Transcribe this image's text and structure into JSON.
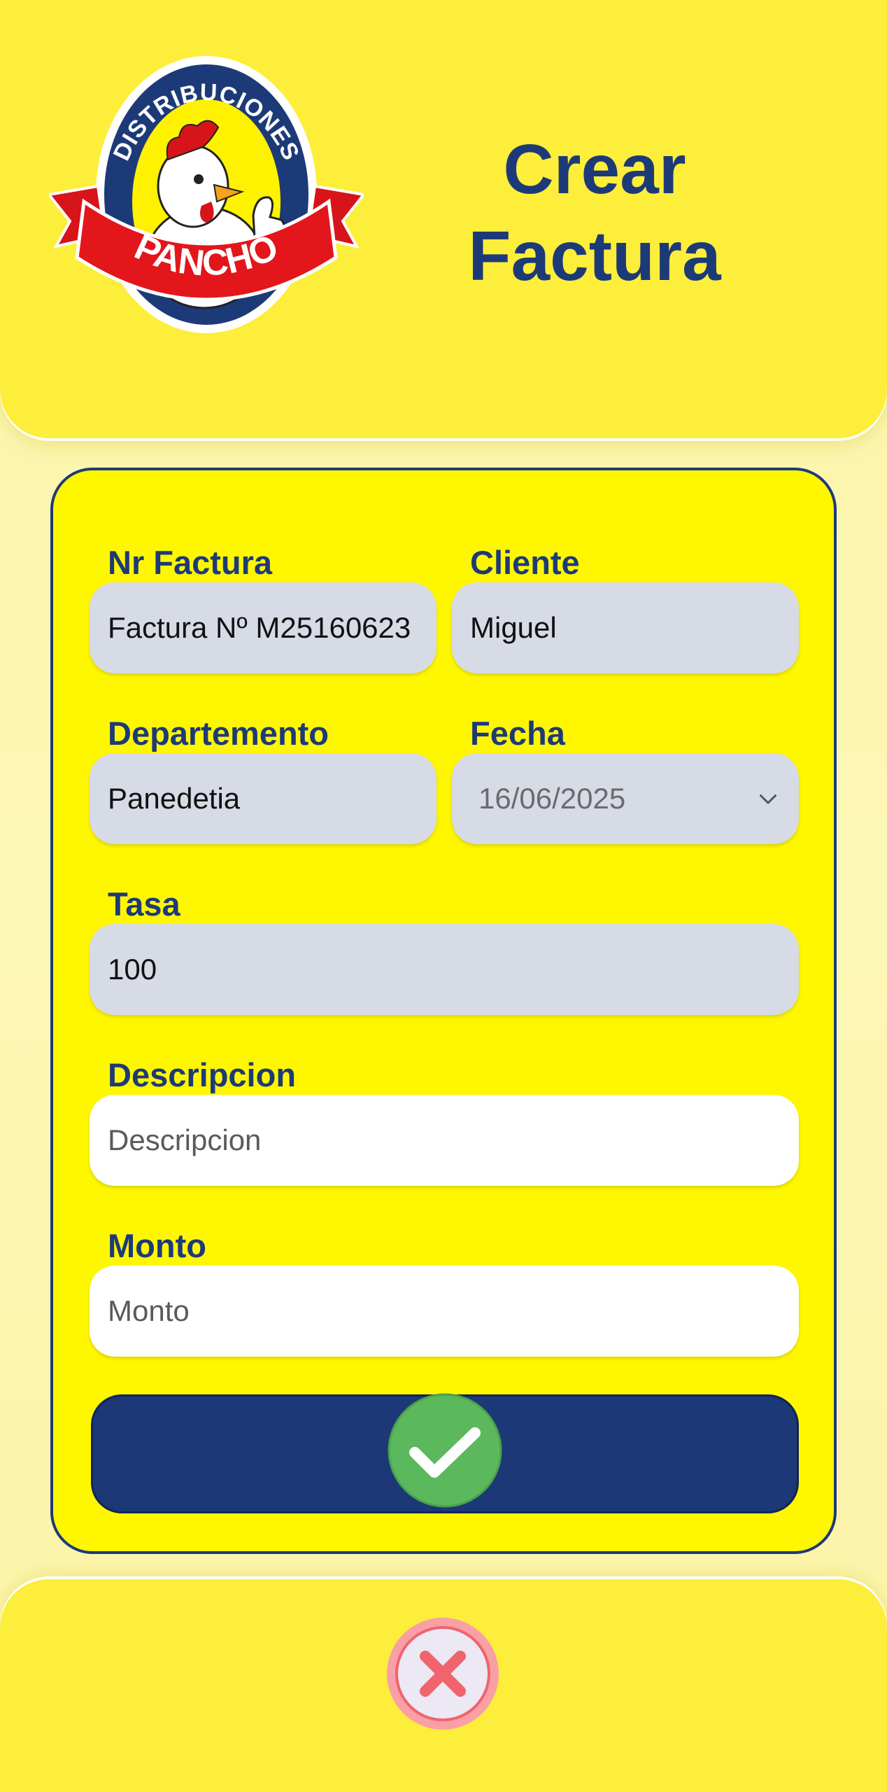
{
  "header": {
    "title_line1": "Crear",
    "title_line2": "Factura",
    "logo": {
      "top_text": "DISTRIBUCIONES",
      "ribbon_text": "PANCHO",
      "icon": "rooster-thumbs-up-logo"
    }
  },
  "form": {
    "nr_factura": {
      "label": "Nr Factura",
      "value": "Factura Nº M25160623"
    },
    "cliente": {
      "label": "Cliente",
      "value": "Miguel"
    },
    "departamento": {
      "label": "Departemento",
      "value": "Panedetia"
    },
    "fecha": {
      "label": "Fecha",
      "value": "16/06/2025",
      "icon": "chevron-down-icon"
    },
    "tasa": {
      "label": "Tasa",
      "value": "100"
    },
    "descripcion": {
      "label": "Descripcion",
      "placeholder": "Descripcion",
      "value": ""
    },
    "monto": {
      "label": "Monto",
      "placeholder": "Monto",
      "value": ""
    },
    "submit": {
      "icon": "check-icon"
    }
  },
  "footer": {
    "close": {
      "icon": "close-icon"
    }
  },
  "colors": {
    "primary": "#1d3a78",
    "card_bg": "#fff700",
    "header_bg": "#fcee3a",
    "page_bg": "#fbf3a6",
    "readonly_field": "#d7dbe6",
    "success": "#5cb85c",
    "danger": "#f0646e"
  }
}
